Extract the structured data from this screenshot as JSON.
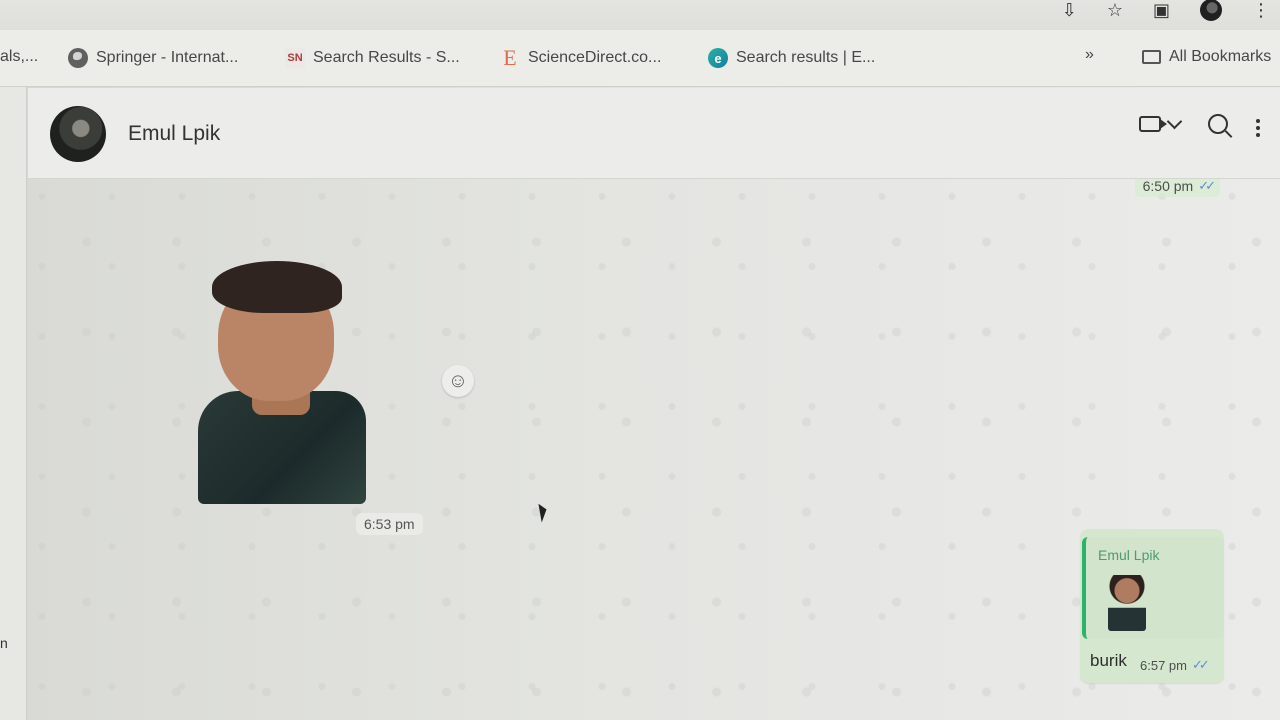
{
  "browser": {
    "actions": {
      "download_icon": "download-icon",
      "star_icon": "star-icon",
      "extensions_icon": "extensions-icon",
      "profile_icon": "profile-icon",
      "menu_icon": "more-vertical-icon"
    }
  },
  "bookmarks": {
    "partial_left": "als,...",
    "items": [
      {
        "label": "Springer - Internat...",
        "icon": "globe-icon"
      },
      {
        "label": "Search Results - S...",
        "icon": "sn-icon",
        "icon_text": "SN"
      },
      {
        "label": "ScienceDirect.co...",
        "icon": "elsevier-icon",
        "icon_text": "E"
      },
      {
        "label": "Search results | E...",
        "icon": "e-search-icon",
        "icon_text": "e"
      }
    ],
    "overflow_label": "»",
    "all_bookmarks_label": "All Bookmarks"
  },
  "left_panel": {
    "fragments": [
      {
        "text": "n"
      }
    ]
  },
  "chat": {
    "contact_name": "Emul Lpik",
    "header_icons": {
      "video": "video-call-icon",
      "chevron": "chevron-down-icon",
      "search": "search-icon",
      "menu": "more-vertical-icon"
    },
    "messages": {
      "previous_outgoing_time": "6:50 pm",
      "sticker_time": "6:53 pm",
      "reaction_icon": "emoji-icon",
      "reply": {
        "quoted_author": "Emul Lpik",
        "text": "burik",
        "time": "6:57 pm"
      }
    }
  }
}
